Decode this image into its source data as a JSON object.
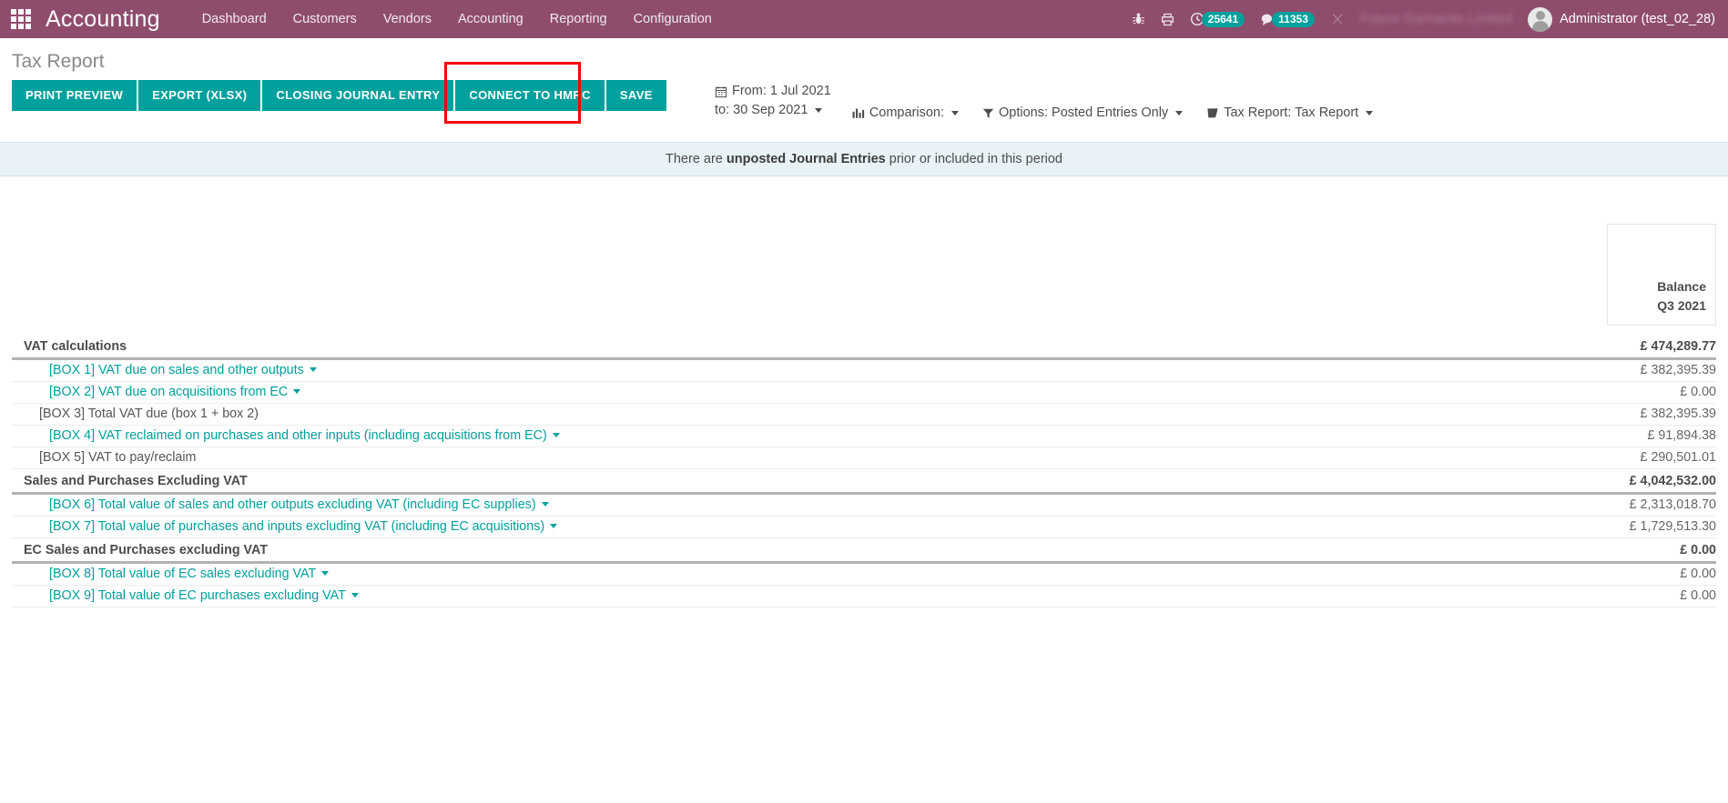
{
  "navbar": {
    "apps_icon": "apps-grid-icon",
    "brand": "Accounting",
    "menu": [
      "Dashboard",
      "Customers",
      "Vendors",
      "Accounting",
      "Reporting",
      "Configuration"
    ],
    "right": {
      "debug_icon": "bug-icon",
      "print_icon": "printer-icon",
      "activity_icon": "clock-icon",
      "activity_count": "25641",
      "messages_icon": "chat-bubble-icon",
      "messages_count": "11353",
      "shortcut_icon": "scissors-icon",
      "company_name": "Future Garments Limited",
      "avatar_icon": "user-avatar-icon",
      "user_label": "Administrator (test_02_28)"
    },
    "accent": "#8f4d6e",
    "badge_color": "#00a09d"
  },
  "control_panel": {
    "page_title": "Tax Report",
    "buttons": [
      {
        "label": "PRINT PREVIEW",
        "name": "print-preview-button"
      },
      {
        "label": "EXPORT (XLSX)",
        "name": "export-xlsx-button"
      },
      {
        "label": "CLOSING JOURNAL ENTRY",
        "name": "closing-journal-entry-button"
      },
      {
        "label": "CONNECT TO HMRC",
        "name": "connect-to-hmrc-button"
      },
      {
        "label": "SAVE",
        "name": "save-button"
      }
    ],
    "highlight_color": "#f80000",
    "button_color": "#00a09d",
    "filters": {
      "date_from": "From: 1 Jul 2021",
      "date_to": "to: 30 Sep 2021",
      "comparison": "Comparison:",
      "options": "Options: Posted Entries Only",
      "report": "Tax Report: Tax Report"
    }
  },
  "alert": {
    "prefix": "There are ",
    "strong": "unposted Journal Entries",
    "suffix": " prior or included in this period"
  },
  "report": {
    "column_header": {
      "line1": "Balance",
      "line2": "Q3 2021"
    },
    "rows": [
      {
        "kind": "section",
        "label": "VAT calculations",
        "value": "£ 474,289.77"
      },
      {
        "kind": "link",
        "label": "[BOX 1] VAT due on sales and other outputs",
        "value": "£ 382,395.39"
      },
      {
        "kind": "link",
        "label": "[BOX 2] VAT due on acquisitions from EC",
        "value": "£ 0.00"
      },
      {
        "kind": "plain",
        "label": "[BOX 3] Total VAT due (box 1 + box 2)",
        "value": "£ 382,395.39"
      },
      {
        "kind": "link",
        "label": "[BOX 4] VAT reclaimed on purchases and other inputs (including acquisitions from EC)",
        "value": "£ 91,894.38"
      },
      {
        "kind": "plain",
        "label": "[BOX 5] VAT to pay/reclaim",
        "value": "£ 290,501.01"
      },
      {
        "kind": "section",
        "label": "Sales and Purchases Excluding VAT",
        "value": "£ 4,042,532.00"
      },
      {
        "kind": "link",
        "label": "[BOX 6] Total value of sales and other outputs excluding VAT (including EC supplies)",
        "value": "£ 2,313,018.70"
      },
      {
        "kind": "link",
        "label": "[BOX 7] Total value of purchases and inputs excluding VAT (including EC acquisitions)",
        "value": "£ 1,729,513.30"
      },
      {
        "kind": "section",
        "label": "EC Sales and Purchases excluding VAT",
        "value": "£ 0.00"
      },
      {
        "kind": "link",
        "label": "[BOX 8] Total value of EC sales excluding VAT",
        "value": "£ 0.00"
      },
      {
        "kind": "link",
        "label": "[BOX 9] Total value of EC purchases excluding VAT",
        "value": "£ 0.00"
      }
    ]
  }
}
